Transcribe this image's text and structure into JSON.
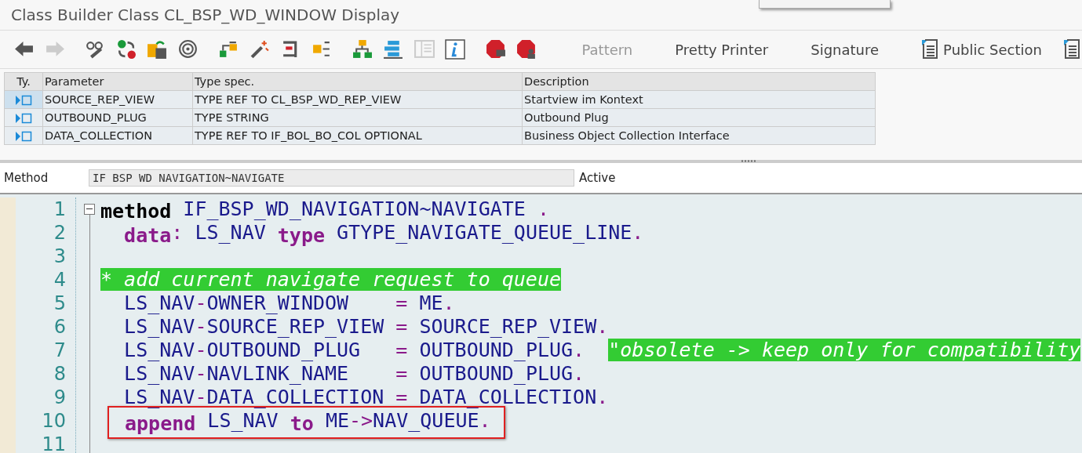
{
  "window": {
    "title": "Class Builder Class CL_BSP_WD_WINDOW Display"
  },
  "toolbar": {
    "icon_buttons": [
      {
        "disabled": false
      },
      {
        "disabled": true
      },
      {
        "disabled": false
      },
      {
        "disabled": false
      },
      {
        "disabled": false
      },
      {
        "disabled": false
      },
      {
        "disabled": false
      },
      {
        "disabled": false
      },
      {
        "disabled": false
      },
      {
        "disabled": false
      },
      {
        "disabled": false
      },
      {
        "disabled": false
      },
      {
        "disabled": true
      },
      {
        "disabled": false
      },
      {
        "disabled": false
      },
      {
        "disabled": false
      }
    ],
    "text_buttons": [
      {
        "label": "Pattern",
        "disabled": true
      },
      {
        "label": "Pretty Printer",
        "disabled": false
      },
      {
        "label": "Signature",
        "disabled": false
      },
      {
        "label": "Public Section",
        "disabled": false
      }
    ]
  },
  "parameters": {
    "columns": [
      "Ty.",
      "Parameter",
      "Type spec.",
      "Description"
    ],
    "rows": [
      {
        "selected": true,
        "parameter": "SOURCE_REP_VIEW",
        "type_spec": "TYPE REF TO CL_BSP_WD_REP_VIEW",
        "description": "Startview im Kontext"
      },
      {
        "selected": false,
        "parameter": "OUTBOUND_PLUG",
        "type_spec": "TYPE STRING",
        "description": "Outbound Plug"
      },
      {
        "selected": false,
        "parameter": "DATA_COLLECTION",
        "type_spec": "TYPE REF TO IF_BOL_BO_COL OPTIONAL",
        "description": "Business Object Collection Interface"
      }
    ]
  },
  "method_bar": {
    "label": "Method",
    "value": "IF_BSP_WD_NAVIGATION~NAVIGATE",
    "status": "Active"
  },
  "editor": {
    "lines": [
      {
        "number": "1",
        "tokens": [
          {
            "kind": "statement",
            "text": "method"
          },
          {
            "kind": "ident",
            "text": " IF_BSP_WD_NAVIGATION~NAVIGATE "
          },
          {
            "kind": "op",
            "text": "."
          }
        ]
      },
      {
        "number": "2",
        "tokens": [
          {
            "kind": "keyword",
            "text": "  data"
          },
          {
            "kind": "op",
            "text": ":"
          },
          {
            "kind": "ident",
            "text": " LS_NAV "
          },
          {
            "kind": "keyword",
            "text": "type"
          },
          {
            "kind": "ident",
            "text": " GTYPE_NAVIGATE_QUEUE_LINE"
          },
          {
            "kind": "op",
            "text": "."
          }
        ]
      },
      {
        "number": "3"
      },
      {
        "number": "4",
        "tokens": [
          {
            "kind": "comment",
            "text": "* add current navigate request to queue"
          }
        ]
      },
      {
        "number": "5",
        "tokens": [
          {
            "kind": "ident",
            "text": "  LS_NAV"
          },
          {
            "kind": "op",
            "text": "-"
          },
          {
            "kind": "ident",
            "text": "OWNER_WINDOW    "
          },
          {
            "kind": "op",
            "text": "="
          },
          {
            "kind": "ident",
            "text": " ME"
          },
          {
            "kind": "op",
            "text": "."
          }
        ]
      },
      {
        "number": "6",
        "tokens": [
          {
            "kind": "ident",
            "text": "  LS_NAV"
          },
          {
            "kind": "op",
            "text": "-"
          },
          {
            "kind": "ident",
            "text": "SOURCE_REP_VIEW "
          },
          {
            "kind": "op",
            "text": "="
          },
          {
            "kind": "ident",
            "text": " SOURCE_REP_VIEW"
          },
          {
            "kind": "op",
            "text": "."
          }
        ]
      },
      {
        "number": "7",
        "tokens": [
          {
            "kind": "ident",
            "text": "  LS_NAV"
          },
          {
            "kind": "op",
            "text": "-"
          },
          {
            "kind": "ident",
            "text": "OUTBOUND_PLUG   "
          },
          {
            "kind": "op",
            "text": "="
          },
          {
            "kind": "ident",
            "text": " OUTBOUND_PLUG"
          },
          {
            "kind": "op",
            "text": ".  "
          },
          {
            "kind": "comment",
            "text": "\"obsolete -> keep only for compatibility"
          }
        ]
      },
      {
        "number": "8",
        "tokens": [
          {
            "kind": "ident",
            "text": "  LS_NAV"
          },
          {
            "kind": "op",
            "text": "-"
          },
          {
            "kind": "ident",
            "text": "NAVLINK_NAME    "
          },
          {
            "kind": "op",
            "text": "="
          },
          {
            "kind": "ident",
            "text": " OUTBOUND_PLUG"
          },
          {
            "kind": "op",
            "text": "."
          }
        ]
      },
      {
        "number": "9",
        "tokens": [
          {
            "kind": "ident",
            "text": "  LS_NAV"
          },
          {
            "kind": "op",
            "text": "-"
          },
          {
            "kind": "ident",
            "text": "DATA_COLLECTION "
          },
          {
            "kind": "op",
            "text": "="
          },
          {
            "kind": "ident",
            "text": " DATA_COLLECTION"
          },
          {
            "kind": "op",
            "text": "."
          }
        ]
      },
      {
        "number": "10",
        "boxed": true,
        "tokens": [
          {
            "kind": "keyword",
            "text": "append"
          },
          {
            "kind": "ident",
            "text": " LS_NAV "
          },
          {
            "kind": "keyword",
            "text": "to"
          },
          {
            "kind": "ident",
            "text": " ME"
          },
          {
            "kind": "op",
            "text": "->"
          },
          {
            "kind": "ident",
            "text": "NAV_QUEUE"
          },
          {
            "kind": "op",
            "text": "."
          }
        ]
      },
      {
        "number": "11"
      }
    ]
  }
}
